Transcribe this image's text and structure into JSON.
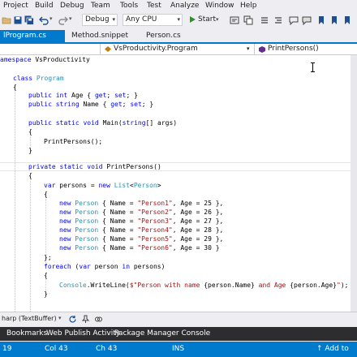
{
  "menu": [
    "Project",
    "Build",
    "Debug",
    "Team",
    "Tools",
    "Test",
    "Analyze",
    "Window",
    "Help"
  ],
  "toolbar": {
    "config": "Debug",
    "platform": "Any CPU",
    "start_label": "Start"
  },
  "tabs": [
    {
      "label": "lProgram.cs",
      "active": true
    },
    {
      "label": "Method.snippet",
      "active": false
    },
    {
      "label": "Person.cs",
      "active": false
    }
  ],
  "navbar": {
    "type": "VsProductivity.Program",
    "member": "PrintPersons()"
  },
  "code": {
    "namespace": [
      "amespace",
      "VsProductivity"
    ],
    "class_kw": "class",
    "class_name": "Program",
    "open": "{",
    "close": "}",
    "age_prop": [
      "public",
      "int",
      "Age",
      "{",
      "get",
      "; ",
      "set",
      "; }"
    ],
    "name_prop": [
      "public",
      "string",
      "Name",
      "{",
      "get",
      "; ",
      "set",
      "; }"
    ],
    "main_sig": [
      "public",
      "static",
      "void",
      "Main(",
      "string",
      "[] args)"
    ],
    "print_call": "PrintPersons();",
    "print_sig": [
      "private",
      "static",
      "void",
      "PrintPersons()"
    ],
    "var_line": [
      "var",
      "persons = ",
      "new",
      "List",
      "<",
      "Person",
      ">"
    ],
    "new_kw": "new",
    "person_type": "Person",
    "persons": [
      {
        "name": "\"Person1\"",
        "age": "25"
      },
      {
        "name": "\"Person2\"",
        "age": "26"
      },
      {
        "name": "\"Person3\"",
        "age": "27"
      },
      {
        "name": "\"Person4\"",
        "age": "28"
      },
      {
        "name": "\"Person5\"",
        "age": "29"
      },
      {
        "name": "\"Person6\"",
        "age": "30"
      }
    ],
    "close_semicolon": "};",
    "foreach_line": [
      "foreach",
      "(",
      "var",
      "person",
      "in",
      "persons)"
    ],
    "console_line": [
      "Console",
      ".WriteLine(",
      "$\"Person with name ",
      "{person.Name}",
      " and Age ",
      "{person.Age}",
      "\"",
      ");"
    ]
  },
  "zoombar": {
    "buffer": "harp (TextBuffer)"
  },
  "tool_windows": [
    "Bookmarks",
    "Web Publish Activity",
    "Package Manager Console"
  ],
  "status": {
    "line": "19",
    "col": "Col 43",
    "ch": "Ch 43",
    "mode": "INS",
    "add": "Add to"
  },
  "colors": {
    "accent": "#007acc",
    "keyword": "#0000ff",
    "type": "#2b91af",
    "string": "#a31515"
  }
}
